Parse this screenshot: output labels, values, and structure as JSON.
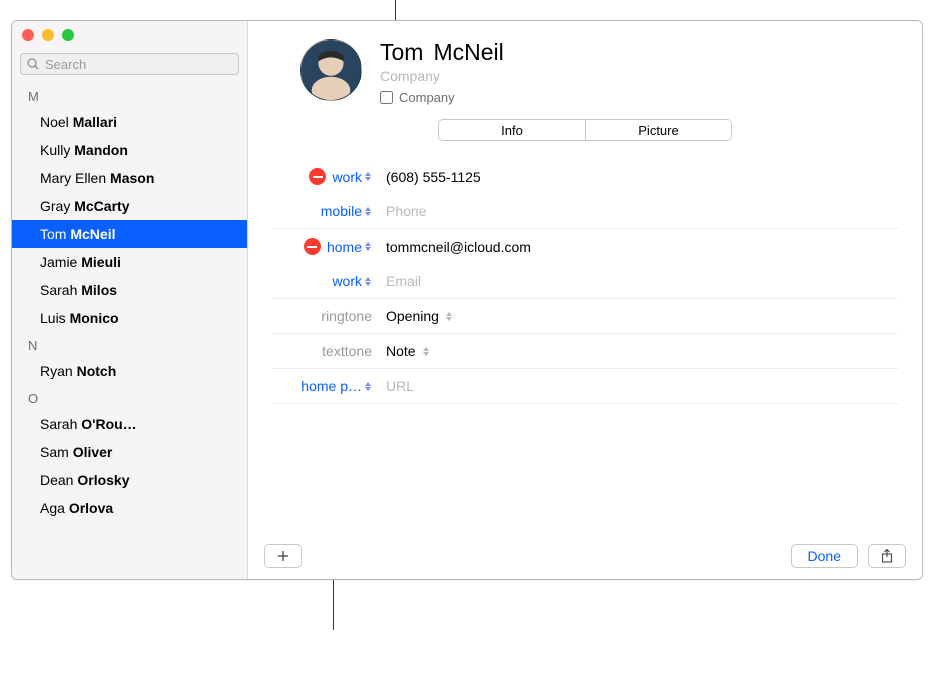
{
  "search": {
    "placeholder": "Search"
  },
  "sections": [
    "M",
    "N",
    "O"
  ],
  "contacts": {
    "m": [
      {
        "first": "Noel",
        "last": "Mallari"
      },
      {
        "first": "Kully",
        "last": "Mandon"
      },
      {
        "first": "Mary Ellen",
        "last": "Mason"
      },
      {
        "first": "Gray",
        "last": "McCarty"
      },
      {
        "first": "Tom",
        "last": "McNeil"
      },
      {
        "first": "Jamie",
        "last": "Mieuli"
      },
      {
        "first": "Sarah",
        "last": "Milos"
      },
      {
        "first": "Luis",
        "last": "Monico"
      }
    ],
    "n": [
      {
        "first": "Ryan",
        "last": "Notch"
      }
    ],
    "o": [
      {
        "first": "Sarah",
        "last": "O'Rou…"
      },
      {
        "first": "Sam",
        "last": "Oliver"
      },
      {
        "first": "Dean",
        "last": "Orlosky"
      },
      {
        "first": "Aga",
        "last": "Orlova"
      }
    ]
  },
  "selected_index": 4,
  "card": {
    "first": "Tom",
    "last": "McNeil",
    "company_placeholder": "Company",
    "company_checkbox_label": "Company",
    "tabs": {
      "info": "Info",
      "picture": "Picture"
    },
    "phone_work_label": "work",
    "phone_work_value": "(608) 555-1125",
    "phone_mobile_label": "mobile",
    "phone_mobile_placeholder": "Phone",
    "email_home_label": "home",
    "email_home_value": "tommcneil@icloud.com",
    "email_work_label": "work",
    "email_work_placeholder": "Email",
    "ringtone_label": "ringtone",
    "ringtone_value": "Opening",
    "texttone_label": "texttone",
    "texttone_value": "Note",
    "homepage_label": "home p…",
    "homepage_placeholder": "URL"
  },
  "footer": {
    "done": "Done"
  }
}
